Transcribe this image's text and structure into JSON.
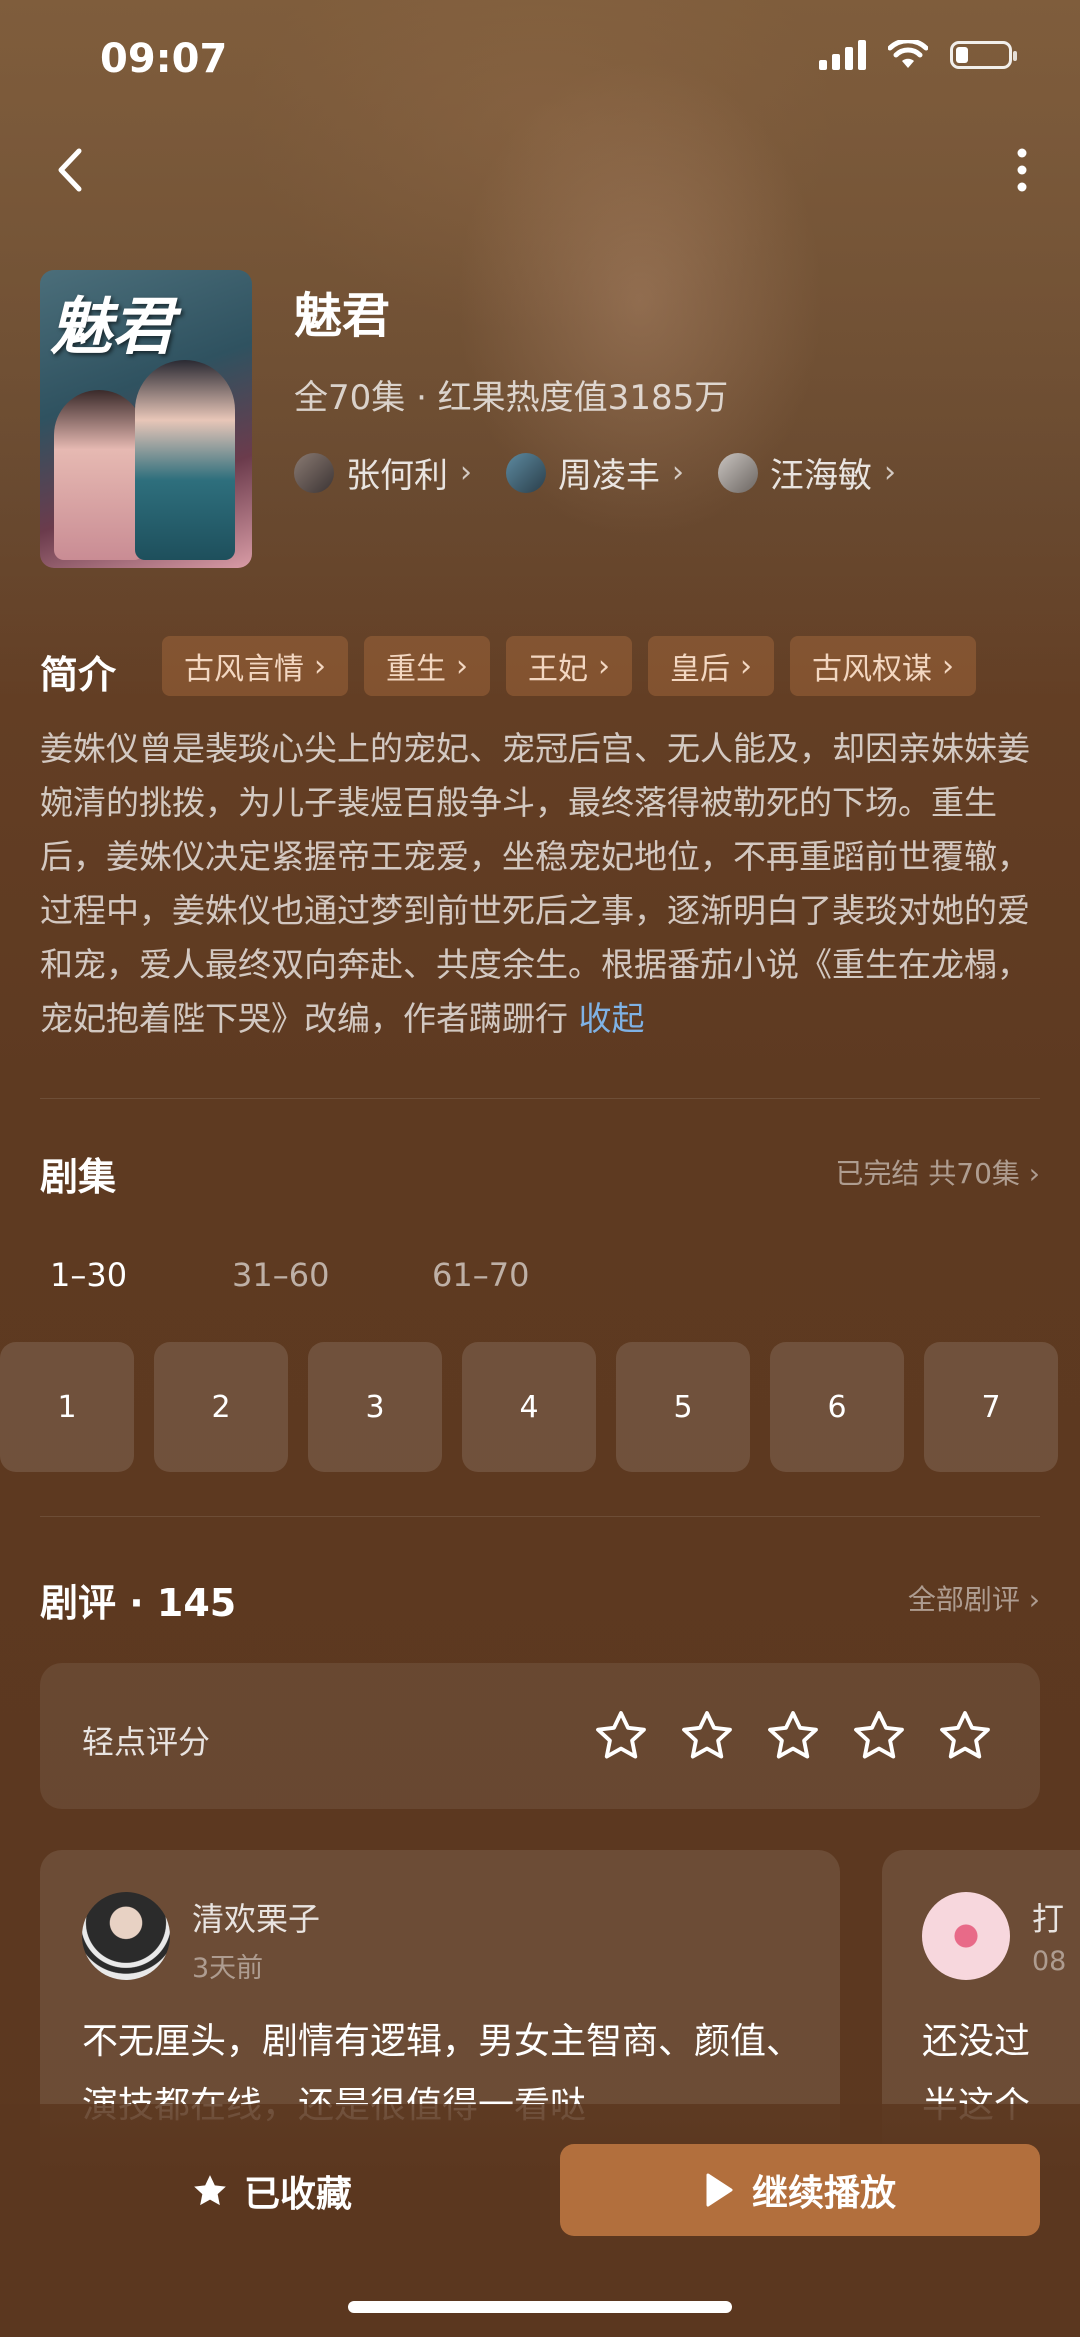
{
  "status_bar": {
    "time": "09:07"
  },
  "show": {
    "title": "魅君",
    "poster_title": "魅君",
    "meta": "全70集 · 红果热度值3185万",
    "cast": [
      {
        "name": "张何利"
      },
      {
        "name": "周凌丰"
      },
      {
        "name": "汪海敏"
      }
    ]
  },
  "intro": {
    "label": "简介",
    "tags": [
      "古风言情",
      "重生",
      "王妃",
      "皇后",
      "古风权谋"
    ],
    "description": "姜姝仪曾是裴琰心尖上的宠妃、宠冠后宫、无人能及，却因亲妹妹姜婉清的挑拨，为儿子裴煜百般争斗，最终落得被勒死的下场。重生后，姜姝仪决定紧握帝王宠爱，坐稳宠妃地位，不再重蹈前世覆辙，过程中，姜姝仪也通过梦到前世死后之事，逐渐明白了裴琰对她的爱和宠，爱人最终双向奔赴、共度余生。根据番茄小说《重生在龙榻，宠妃抱着陛下哭》改编，作者蹒跚行",
    "collapse_label": "收起"
  },
  "episodes": {
    "title": "剧集",
    "status": "已完结 共70集",
    "ranges": [
      "1–30",
      "31–60",
      "61–70"
    ],
    "active_range": 0,
    "items": [
      "1",
      "2",
      "3",
      "4",
      "5",
      "6",
      "7"
    ]
  },
  "reviews": {
    "title": "剧评 · 145",
    "all_label": "全部剧评",
    "rating_prompt": "轻点评分",
    "stars_total": 5,
    "stars_filled": 0,
    "cards": [
      {
        "user": "清欢栗子",
        "time": "3天前",
        "text": "不无厘头，剧情有逻辑，男女主智商、颜值、演技都在线，还是很值得一看哒"
      },
      {
        "user": "打",
        "time": "08",
        "text": "还没过半这个人设"
      }
    ]
  },
  "actions": {
    "favorite_label": "已收藏",
    "play_label": "继续播放"
  },
  "colors": {
    "accent": "#b26f3d",
    "link": "#7fb2e5",
    "background": "#5e3a21"
  }
}
